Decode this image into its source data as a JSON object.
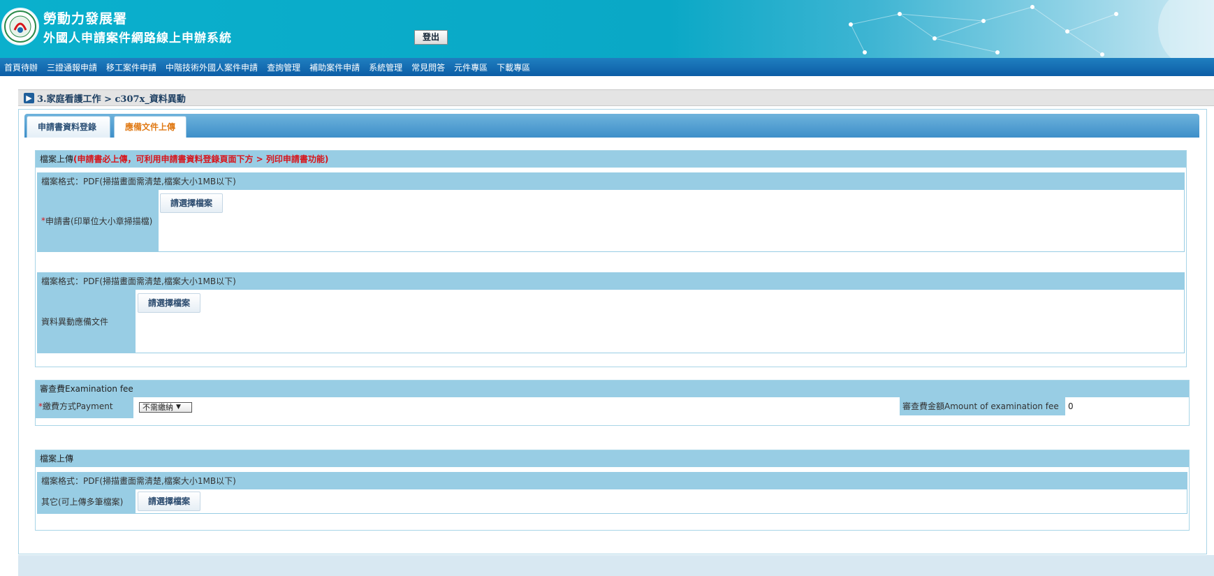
{
  "header": {
    "agency": "勞動力發展署",
    "system": "外國人申請案件網路線上申辦系統",
    "logout_label": "登出",
    "logo_icon": "agency-seal-icon"
  },
  "nav": {
    "items": [
      "首頁待辦",
      "三證通報申請",
      "移工案件申請",
      "中階技術外國人案件申請",
      "查詢管理",
      "補助案件申請",
      "系統管理",
      "常見問答",
      "元件專區",
      "下載專區"
    ]
  },
  "breadcrumb": {
    "text": "3.家庭看護工作 > c307x_資料異動",
    "icon": "arrow-right-icon"
  },
  "tabs": [
    {
      "label": "申請書資料登錄",
      "active": false
    },
    {
      "label": "應備文件上傳",
      "active": true
    }
  ],
  "upload_section": {
    "title": "檔案上傳",
    "note": "(申請書必上傳，可利用申請書資料登錄頁面下方 > 列印申請書功能)",
    "blocks": [
      {
        "format": "檔案格式：PDF(掃描畫面需清楚,檔案大小1MB以下)",
        "required": true,
        "label": "申請書(印單位大小章掃描檔)",
        "button": "請選擇檔案"
      },
      {
        "format": "檔案格式：PDF(掃描畫面需清楚,檔案大小1MB以下)",
        "required": false,
        "label": "資料異動應備文件",
        "button": "請選擇檔案"
      }
    ]
  },
  "fee_section": {
    "title": "審查費Examination fee",
    "payment_label": "繳費方式Payment",
    "payment_selected": "不需繳納",
    "amount_label": "審查費金額Amount of examination fee",
    "amount_value": "0"
  },
  "other_section": {
    "title": "檔案上傳",
    "format": "檔案格式：PDF(掃描畫面需清楚,檔案大小1MB以下)",
    "label": "其它(可上傳多筆檔案)",
    "button": "請選擇檔案"
  },
  "colors": {
    "header_accent": "#0ab0cd",
    "nav_bg": "#0c5da6",
    "section_bg": "#98cde4",
    "required_red": "#d8141a",
    "active_tab_text": "#e07a16"
  }
}
